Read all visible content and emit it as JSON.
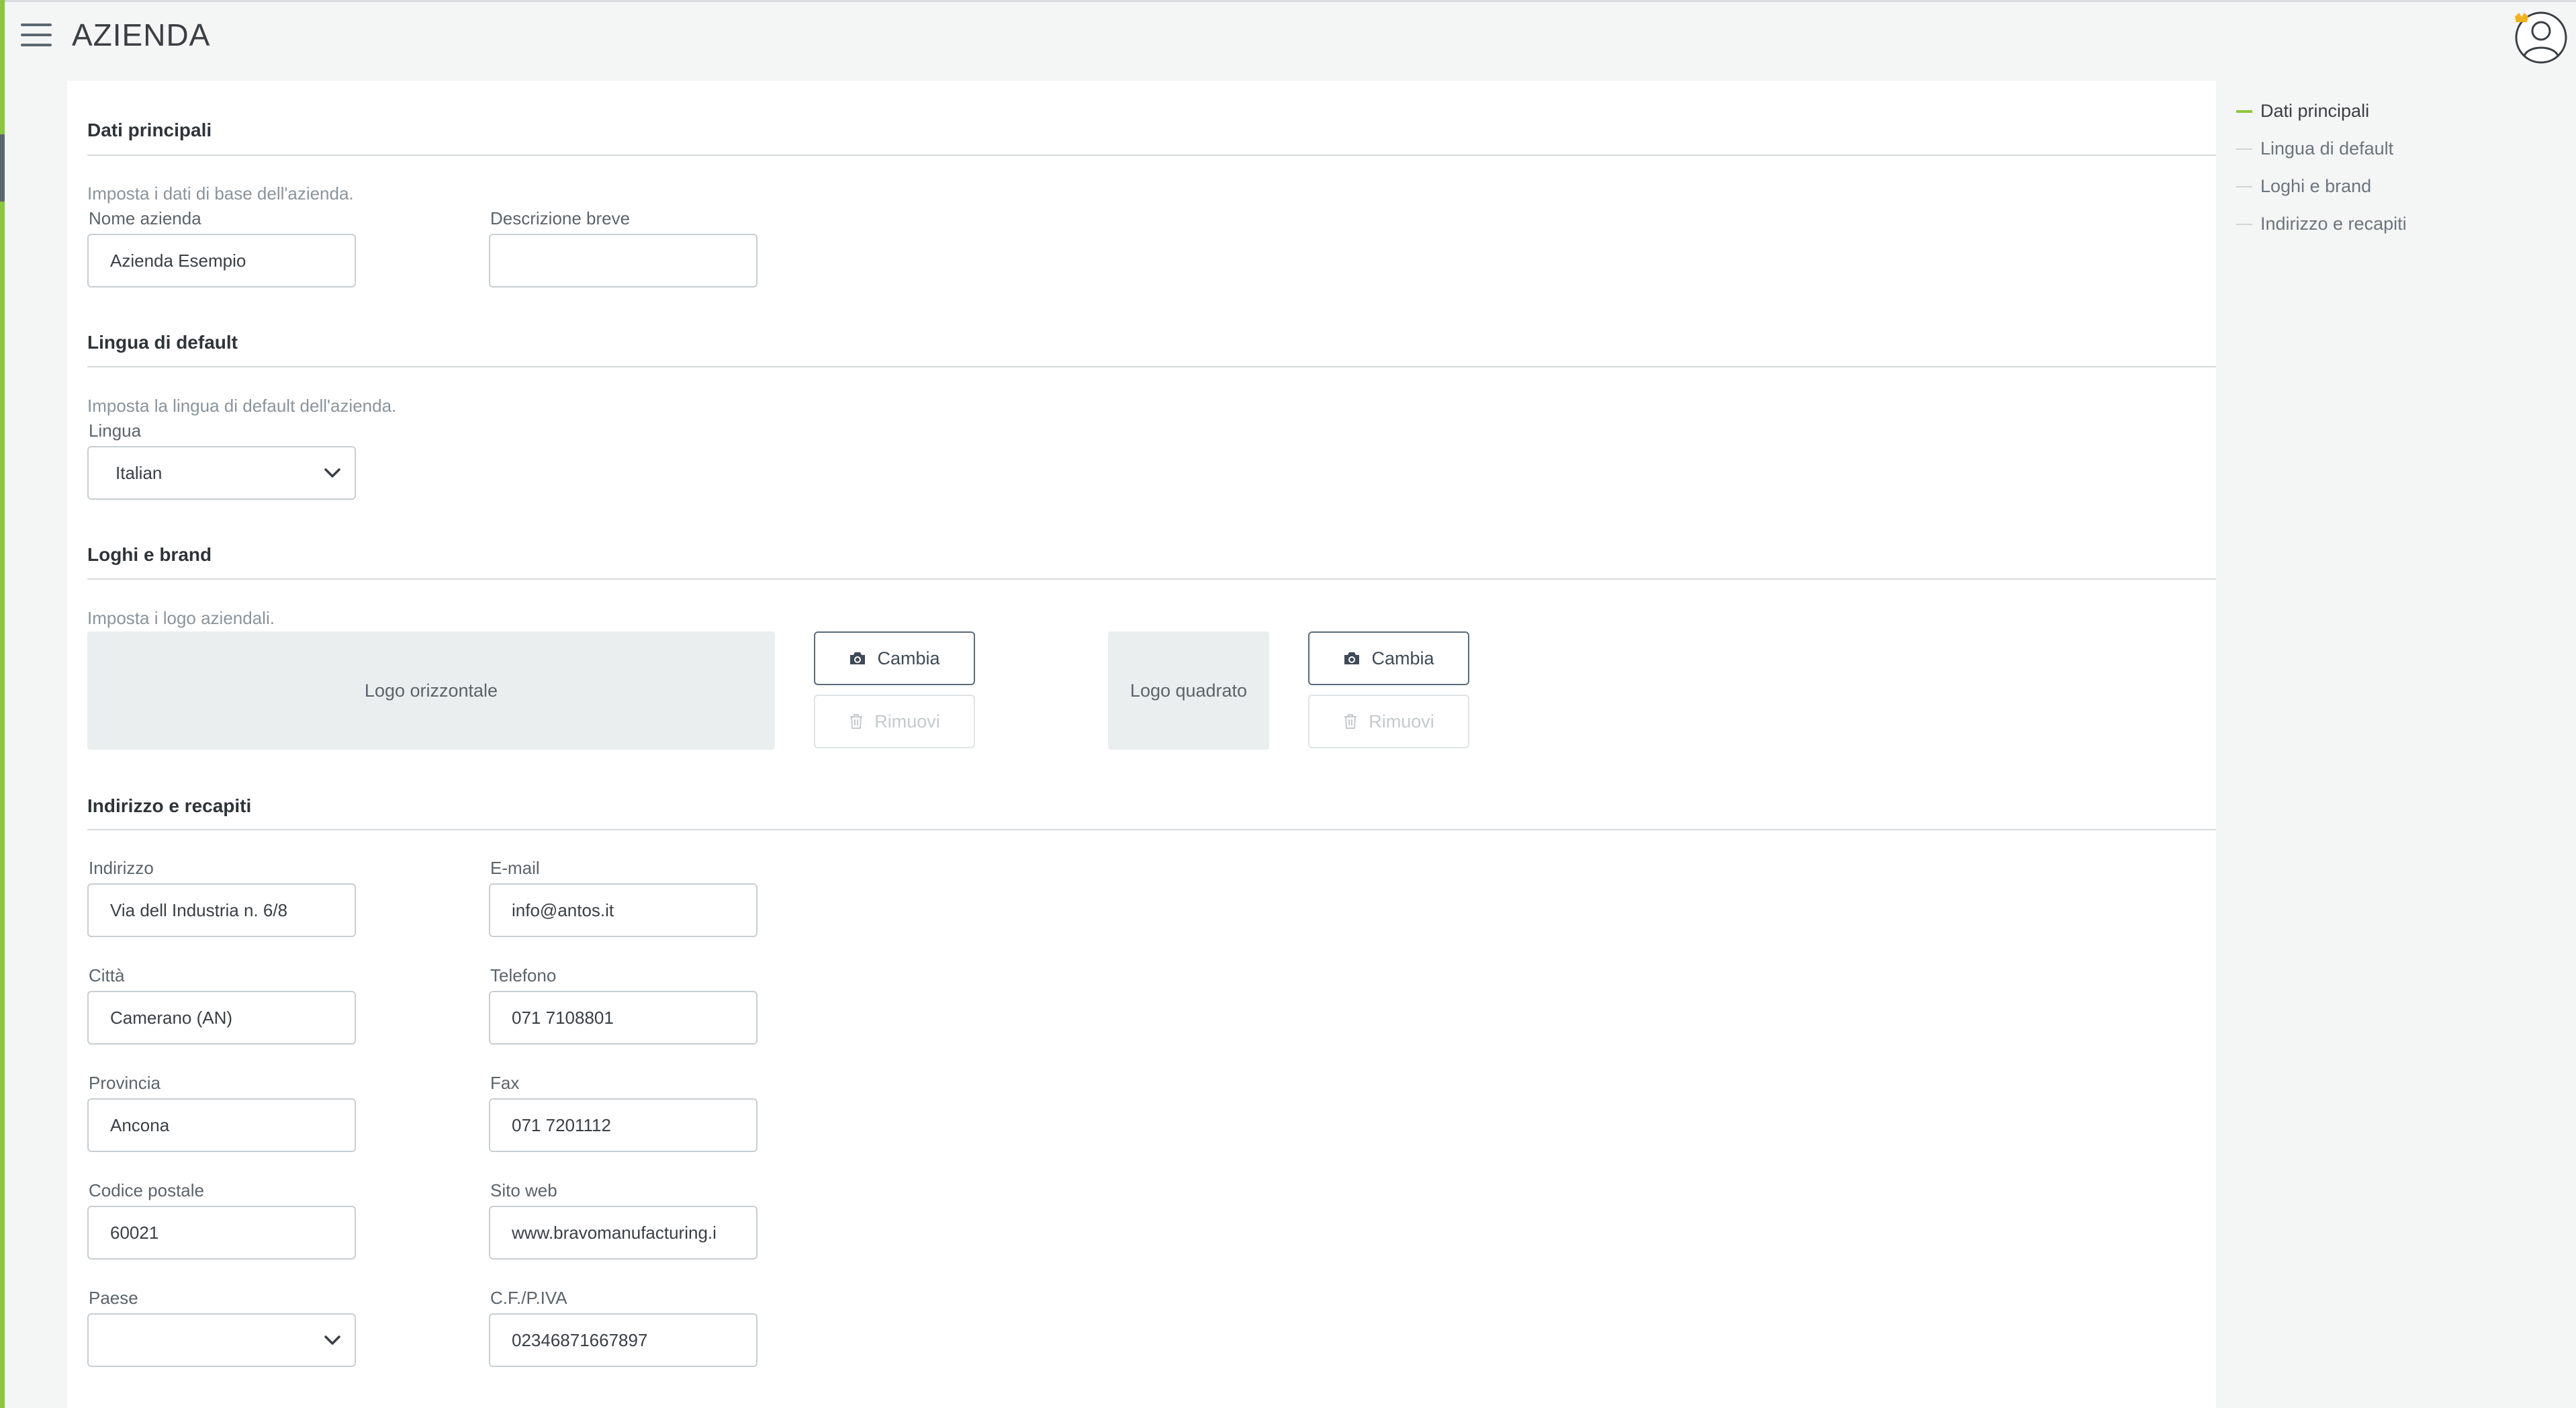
{
  "app": {
    "title": "AZIENDA"
  },
  "toc": {
    "items": [
      {
        "label": "Dati principali"
      },
      {
        "label": "Lingua di default"
      },
      {
        "label": "Loghi e brand"
      },
      {
        "label": "Indirizzo e recapiti"
      }
    ],
    "active": "Dati principali"
  },
  "sections": {
    "main": {
      "title": "Dati principali",
      "description": "Imposta i dati di base dell'azienda.",
      "company_name_label": "Nome azienda",
      "company_name_value": "Azienda Esempio",
      "short_desc_label": "Descrizione breve",
      "short_desc_value": ""
    },
    "language": {
      "title": "Lingua di default",
      "description": "Imposta la lingua di default dell'azienda.",
      "language_label": "Lingua",
      "language_value": "Italian"
    },
    "logos": {
      "title": "Loghi e brand",
      "description": "Imposta i logo aziendali.",
      "horizontal_logo": "Logo orizzontale",
      "square_logo": "Logo quadrato",
      "change_label": "Cambia",
      "remove_label": "Rimuovi"
    },
    "address": {
      "title": "Indirizzo e recapiti",
      "indirizzo_label": "Indirizzo",
      "indirizzo_value": "Via dell Industria n. 6/8",
      "email_label": "E-mail",
      "email_value": "info@antos.it",
      "citta_label": "Città",
      "citta_value": "Camerano (AN)",
      "telefono_label": "Telefono",
      "telefono_value": "071 7108801",
      "provincia_label": "Provincia",
      "provincia_value": "Ancona",
      "fax_label": "Fax",
      "fax_value": "071 7201112",
      "cap_label": "Codice postale",
      "cap_value": "60021",
      "sito_label": "Sito web",
      "sito_value": "www.bravomanufacturing.i",
      "paese_label": "Paese",
      "paese_value": "",
      "cf_label": "C.F./P.IVA",
      "cf_value": "02346871667897"
    }
  },
  "colors": {
    "accent": "#8dc63f",
    "panel": "#ffffff",
    "background": "#f4f5f5",
    "logo_placeholder": "#ebeeee"
  },
  "icons": {
    "menu": "hamburger-icon",
    "avatar": "user-avatar-icon",
    "change": "camera-icon",
    "remove": "trash-icon",
    "select": "chevron-down-icon"
  }
}
